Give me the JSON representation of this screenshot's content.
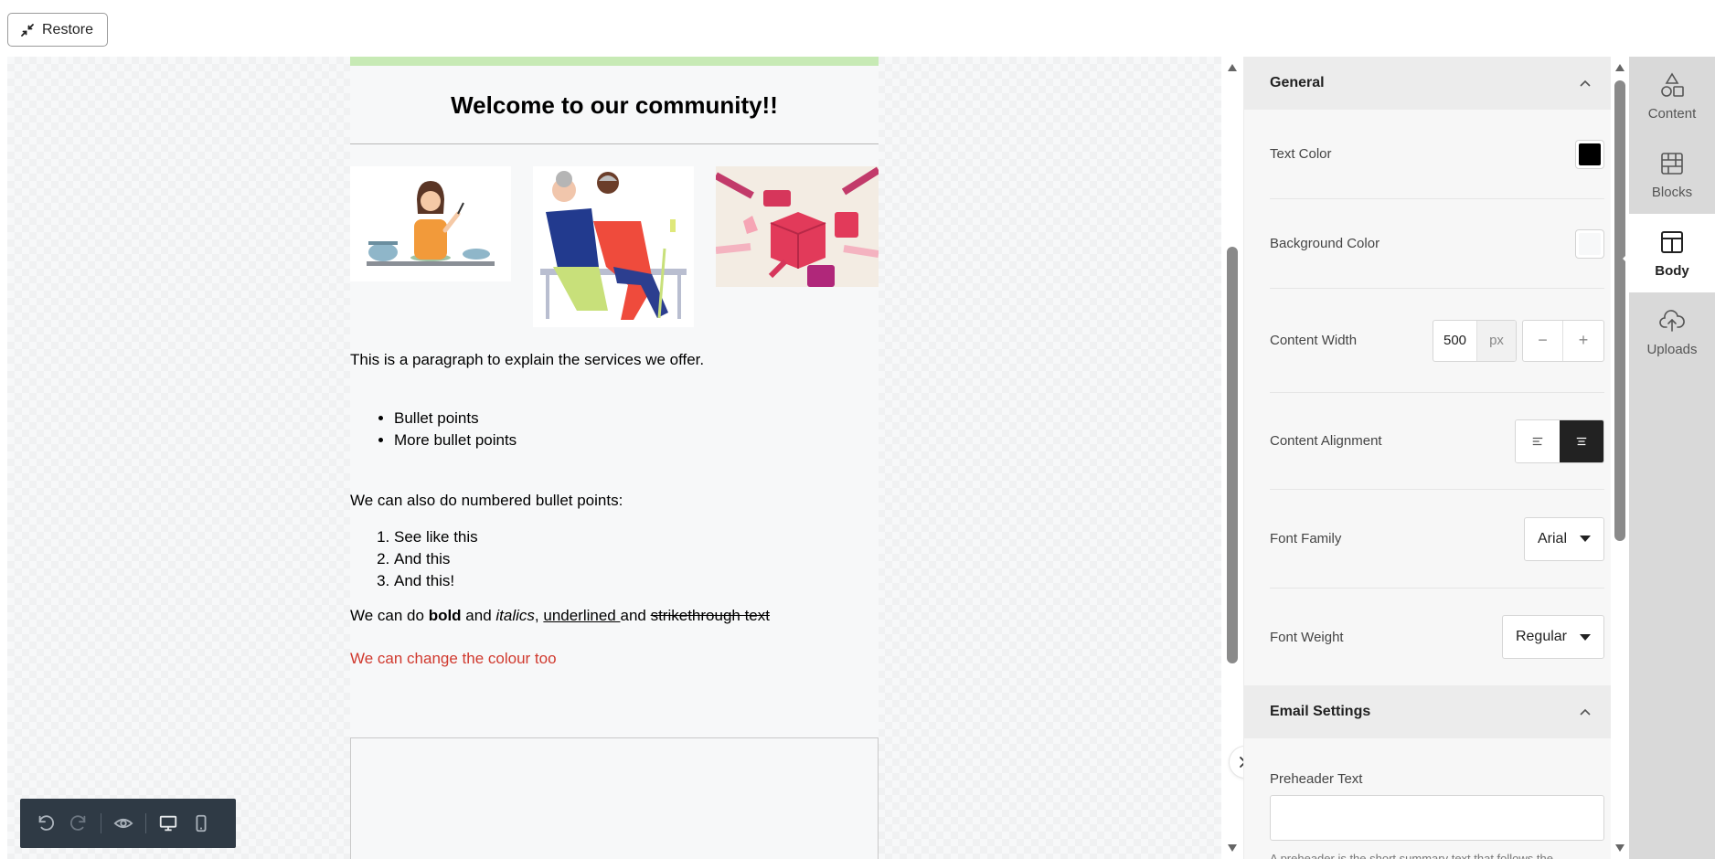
{
  "topbar": {
    "restore_label": "Restore"
  },
  "email": {
    "heading": "Welcome to our community!!",
    "paragraph": "This is a paragraph to explain the services we offer.",
    "bullets": [
      "Bullet points",
      "More bullet points"
    ],
    "numbered_intro": "We can also do numbered bullet points:",
    "numbered": [
      "See like this",
      "And this",
      "And this!"
    ],
    "format": {
      "prefix": "We can do ",
      "bold": "bold",
      "and1": " and ",
      "italic": "italics",
      "comma": ", ",
      "underlined": "underlined ",
      "and2": "and ",
      "strike": "strikethrough text"
    },
    "colour_line": "We can change the colour too",
    "colour_hex": "#d0392e"
  },
  "panel": {
    "general_title": "General",
    "text_color_label": "Text Color",
    "text_color": "#000000",
    "bg_color_label": "Background Color",
    "bg_color": "#f7f8f9",
    "content_width_label": "Content Width",
    "content_width_value": "500",
    "content_width_unit": "px",
    "minus": "−",
    "plus": "+",
    "content_alignment_label": "Content Alignment",
    "font_family_label": "Font Family",
    "font_family_value": "Arial",
    "font_weight_label": "Font Weight",
    "font_weight_value": "Regular",
    "email_settings_title": "Email Settings",
    "preheader_label": "Preheader Text",
    "preheader_value": "",
    "helper_text": "A preheader is the short summary text that follows the"
  },
  "tabs": [
    {
      "label": "Content",
      "icon": "shapes-icon"
    },
    {
      "label": "Blocks",
      "icon": "blocks-icon"
    },
    {
      "label": "Body",
      "icon": "layout-icon"
    },
    {
      "label": "Uploads",
      "icon": "cloud-upload-icon"
    }
  ]
}
